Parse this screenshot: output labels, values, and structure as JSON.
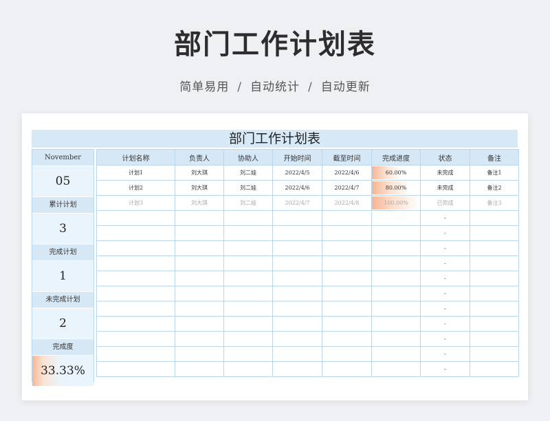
{
  "header": {
    "title": "部门工作计划表",
    "sub_1": "简单易用",
    "sub_2": "自动统计",
    "sub_3": "自动更新",
    "separator": "/"
  },
  "sheet": {
    "title": "部门工作计划表"
  },
  "stats": {
    "month_label": "November",
    "day_value": "05",
    "total_label": "累计计划",
    "total_value": "3",
    "done_label": "完成计划",
    "done_value": "1",
    "undone_label": "未完成计划",
    "undone_value": "2",
    "rate_label": "完成度",
    "rate_value": "33.33%",
    "rate_fraction": 0.3333
  },
  "table": {
    "headers": [
      "计划名称",
      "负责人",
      "协助人",
      "开始时间",
      "截至时间",
      "完成进度",
      "状态",
      "备注"
    ],
    "rows": [
      {
        "name": "计划1",
        "owner": "刘大琪",
        "helper": "刘二娃",
        "start": "2022/4/5",
        "end": "2022/4/6",
        "progress": "60.00%",
        "progress_fraction": 0.6,
        "status": "未完成",
        "note": "备注1"
      },
      {
        "name": "计划2",
        "owner": "刘大琪",
        "helper": "刘二娃",
        "start": "2022/4/6",
        "end": "2022/4/7",
        "progress": "80.00%",
        "progress_fraction": 0.8,
        "status": "未完成",
        "note": "备注2"
      },
      {
        "name": "计划3",
        "owner": "刘大琪",
        "helper": "刘二娃",
        "start": "2022/4/7",
        "end": "2022/4/8",
        "progress": "100.00%",
        "progress_fraction": 1.0,
        "status": "已完成",
        "note": "备注3"
      }
    ],
    "empty_status": "-"
  },
  "colors": {
    "accent_blue": "#d6e7f5",
    "progress_orange": "#f6b594"
  }
}
